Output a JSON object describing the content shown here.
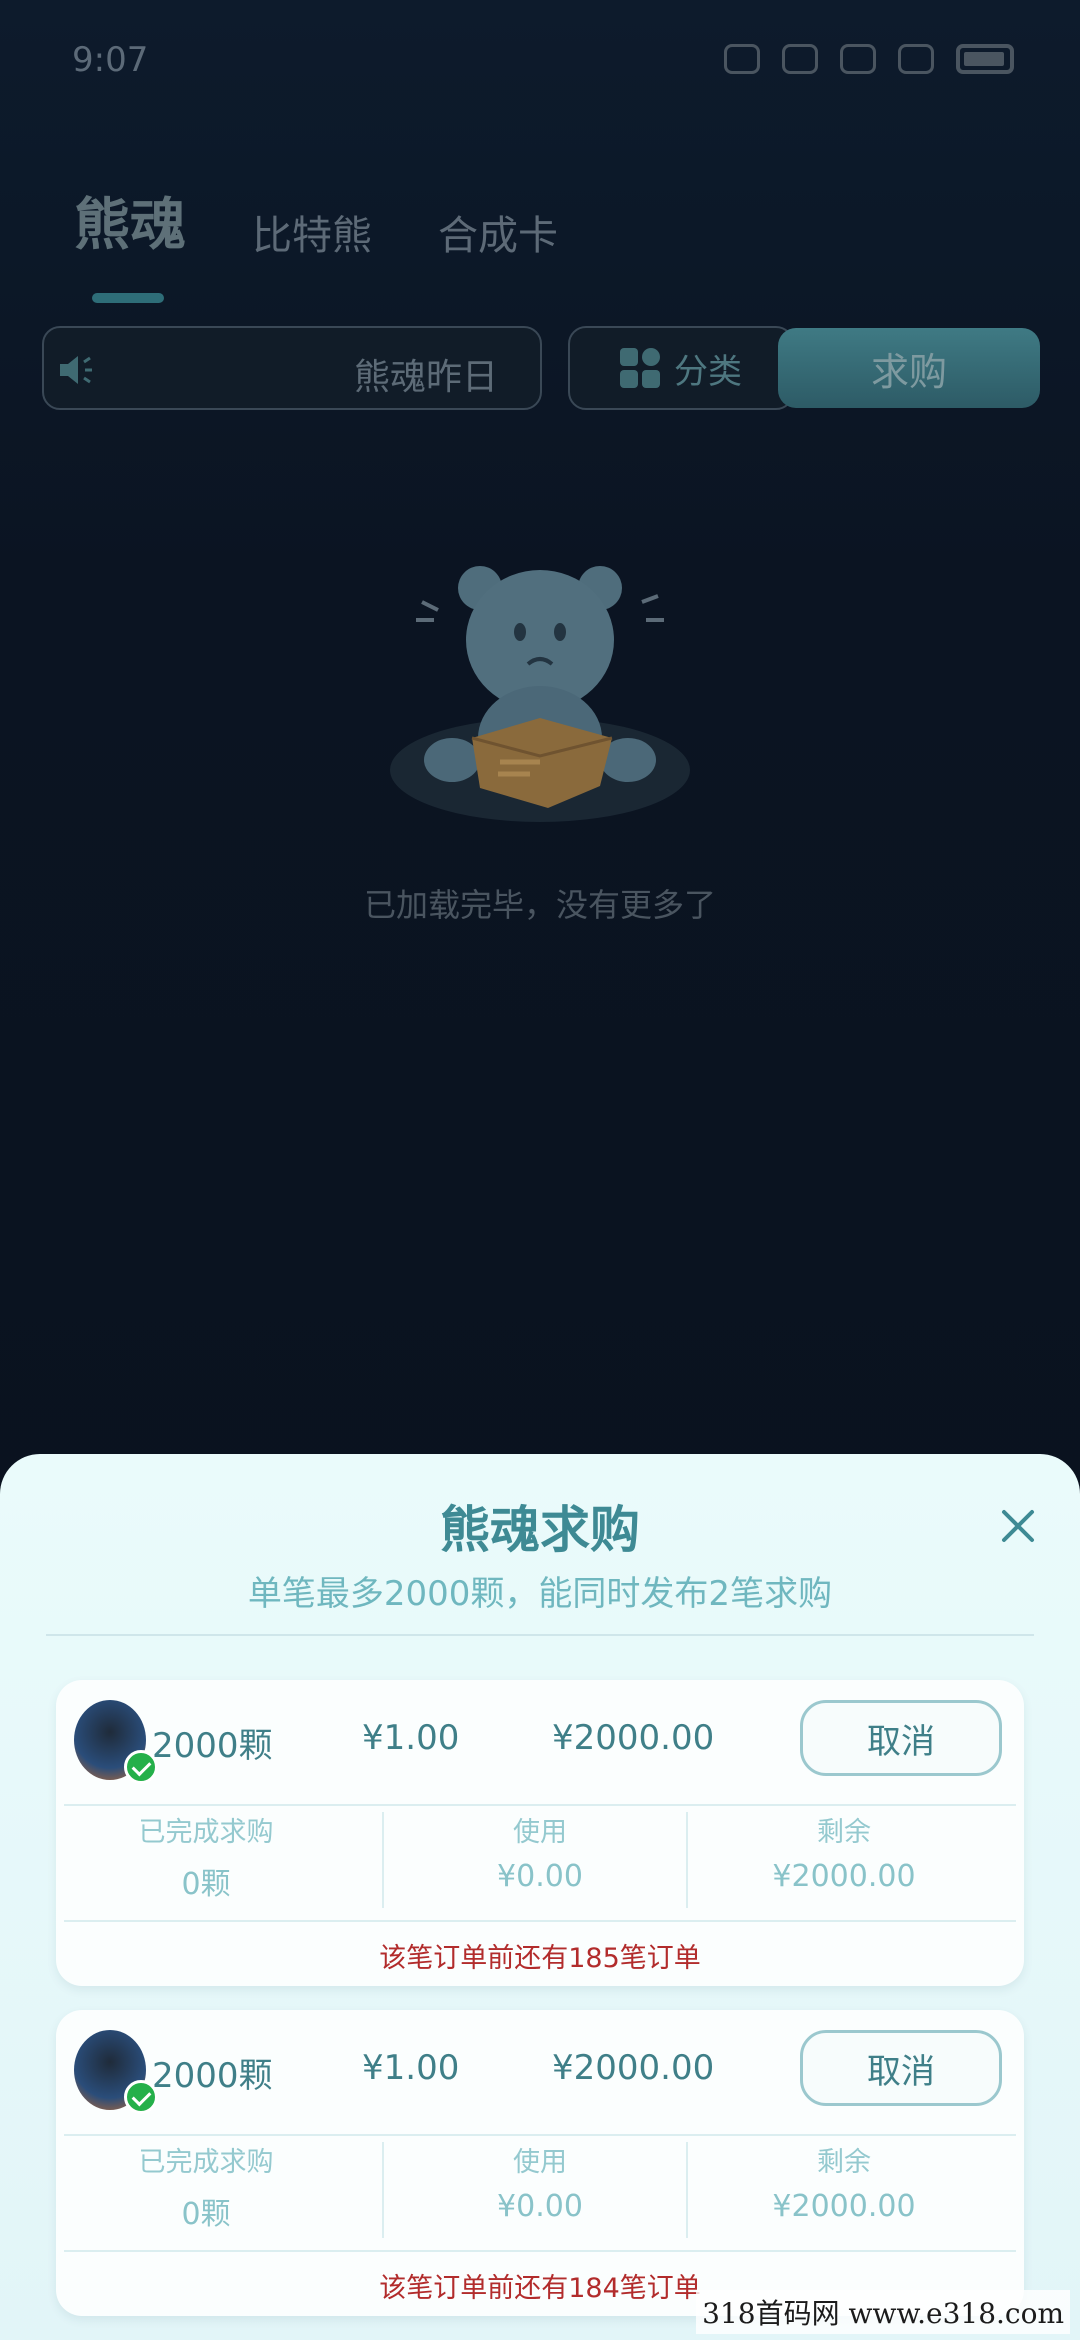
{
  "status_bar": {
    "time": "9:07"
  },
  "tabs": [
    {
      "label": "熊魂",
      "active": true
    },
    {
      "label": "比特熊",
      "active": false
    },
    {
      "label": "合成卡",
      "active": false
    }
  ],
  "toolbar": {
    "notice_text": "熊魂昨日",
    "category_label": "分类",
    "buy_label": "求购"
  },
  "empty_state": {
    "text": "已加载完毕，没有更多了"
  },
  "sheet": {
    "title": "熊魂求购",
    "subtitle": "单笔最多2000颗，能同时发布2笔求购",
    "orders": [
      {
        "quantity": "2000颗",
        "unit_price": "¥1.00",
        "total": "¥2000.00",
        "cancel_label": "取消",
        "completed_label": "已完成求购",
        "completed_value": "0颗",
        "used_label": "使用",
        "used_value": "¥0.00",
        "remaining_label": "剩余",
        "remaining_value": "¥2000.00",
        "queue_text": "该笔订单前还有185笔订单"
      },
      {
        "quantity": "2000颗",
        "unit_price": "¥1.00",
        "total": "¥2000.00",
        "cancel_label": "取消",
        "completed_label": "已完成求购",
        "completed_value": "0颗",
        "used_label": "使用",
        "used_value": "¥0.00",
        "remaining_label": "剩余",
        "remaining_value": "¥2000.00",
        "queue_text": "该笔订单前还有184笔订单"
      }
    ]
  },
  "watermark": "318首码网 www.e318.com",
  "colors": {
    "accent": "#3e8a94",
    "queue_red": "#b22c2c",
    "background": "#0b1422"
  }
}
